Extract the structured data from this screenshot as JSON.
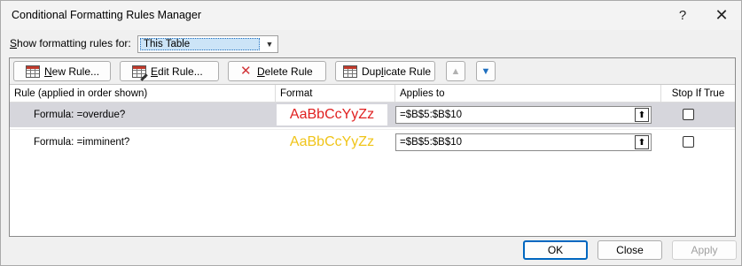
{
  "window": {
    "title": "Conditional Formatting Rules Manager",
    "help_glyph": "?",
    "close_glyph": "✕"
  },
  "filter": {
    "label_underlined": "S",
    "label_rest": "how formatting rules for:",
    "selected": "This Table"
  },
  "toolbar": {
    "new_rule_u": "N",
    "new_rule_rest": "ew Rule...",
    "edit_rule_u": "E",
    "edit_rule_rest": "dit Rule...",
    "delete_rule_u": "D",
    "delete_rule_rest": "elete Rule",
    "duplicate_pre": "Dup",
    "duplicate_u": "l",
    "duplicate_post": "icate Rule"
  },
  "columns": {
    "rule": "Rule (applied in order shown)",
    "format": "Format",
    "applies_to": "Applies to",
    "stop_if_true": "Stop If True"
  },
  "rules": [
    {
      "rule": "Formula: =overdue?",
      "preview": "AaBbCcYyZz",
      "preview_color": "#e02020",
      "applies_to": "=$B$5:$B$10",
      "stop_if_true": false,
      "selected": true
    },
    {
      "rule": "Formula: =imminent?",
      "preview": "AaBbCcYyZz",
      "preview_color": "#f0c419",
      "applies_to": "=$B$5:$B$10",
      "stop_if_true": false,
      "selected": false
    }
  ],
  "buttons": {
    "ok": "OK",
    "close": "Close",
    "apply": "Apply"
  },
  "colors": {
    "accent": "#0067c0",
    "selected_row": "#d6d6dc"
  }
}
